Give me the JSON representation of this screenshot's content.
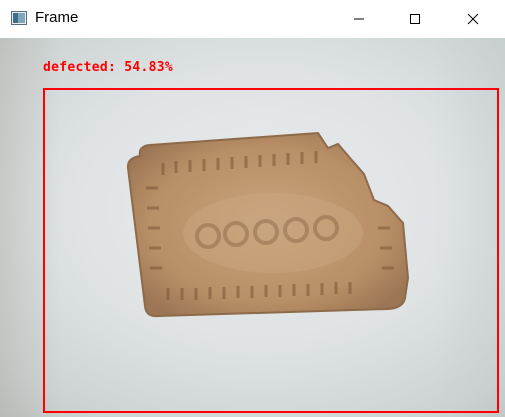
{
  "window": {
    "title": "Frame",
    "controls": {
      "minimize_icon": "minimize-icon",
      "maximize_icon": "maximize-icon",
      "close_icon": "close-icon"
    }
  },
  "detection": {
    "label": "defected: 54.83%",
    "class": "defected",
    "confidence_percent": 54.83,
    "box_color": "#ff0000"
  },
  "frame": {
    "content": "camera frame showing a biscuit with a broken corner"
  }
}
